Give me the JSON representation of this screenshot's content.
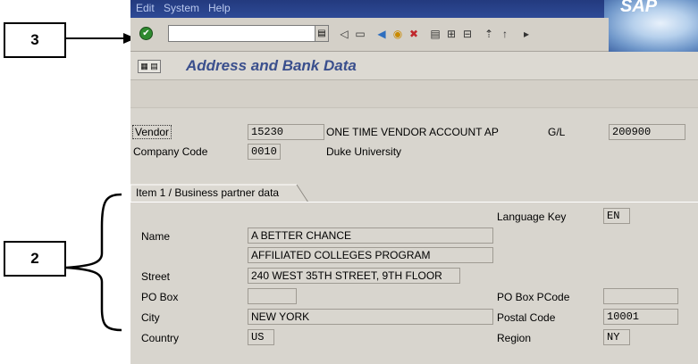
{
  "callouts": {
    "three": "3",
    "two": "2"
  },
  "menu": {
    "items": [
      "Edit",
      "System",
      "Help"
    ]
  },
  "brand": {
    "logo_text": "SAP"
  },
  "toolbar": {
    "command_value": ""
  },
  "title": {
    "text": "Address and Bank Data"
  },
  "header": {
    "vendor_label": "Vendor",
    "vendor_value": "15230",
    "vendor_name": "ONE TIME VENDOR ACCOUNT AP",
    "gl_label": "G/L",
    "gl_value": "200900",
    "company_code_label": "Company Code",
    "company_code_value": "0010",
    "company_name": "Duke University"
  },
  "tab": {
    "label": "Item 1 / Business partner data"
  },
  "form": {
    "language_key_label": "Language Key",
    "language_key_value": "EN",
    "name_label": "Name",
    "name_line1": "A BETTER CHANCE",
    "name_line2": "AFFILIATED COLLEGES PROGRAM",
    "street_label": "Street",
    "street_value": "240 WEST 35TH STREET, 9TH FLOOR",
    "po_box_label": "PO Box",
    "po_box_value": "",
    "po_box_pcode_label": "PO Box PCode",
    "po_box_pcode_value": "",
    "city_label": "City",
    "city_value": "NEW YORK",
    "postal_code_label": "Postal Code",
    "postal_code_value": "10001",
    "country_label": "Country",
    "country_value": "US",
    "region_label": "Region",
    "region_value": "NY"
  }
}
